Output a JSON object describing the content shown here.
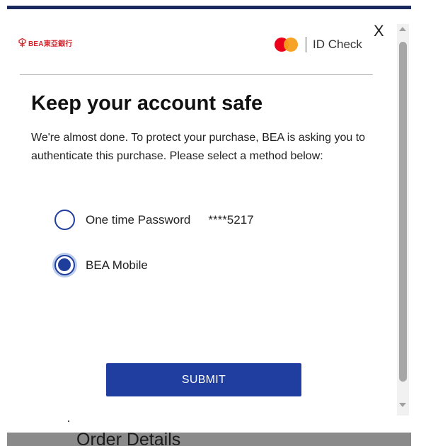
{
  "dialog": {
    "close_label": "X",
    "bank_logo_text": "BEA東亞銀行",
    "brand_text": "ID Check",
    "title": "Keep your account safe",
    "description": "We're almost done. To protect your purchase, BEA is asking you to authenticate this purchase. Please select a method below:",
    "options": [
      {
        "label": "One time Password",
        "masked": "****5217",
        "selected": false
      },
      {
        "label": "BEA Mobile",
        "selected": true
      }
    ],
    "submit_label": "SUBMIT"
  },
  "background": {
    "section_title": "Order Details"
  },
  "colors": {
    "top_bar": "#1a2a5e",
    "accent": "#203da0",
    "bea_red": "#d4242a",
    "mastercard_red": "#eb001b",
    "mastercard_yellow": "#f79e1b"
  },
  "icons": {
    "bank_logo": "bea-logo-icon",
    "card_brand": "mastercard-icon"
  }
}
